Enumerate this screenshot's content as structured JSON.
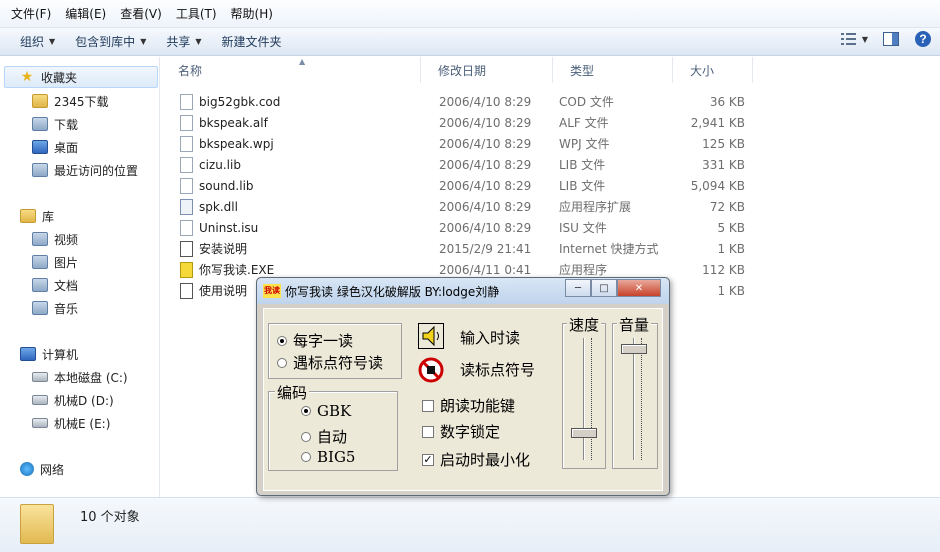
{
  "menu": [
    "文件(F)",
    "编辑(E)",
    "查看(V)",
    "工具(T)",
    "帮助(H)"
  ],
  "toolbar": {
    "organize": "组织",
    "include_in_library": "包含到库中",
    "share": "共享",
    "new_folder": "新建文件夹"
  },
  "sidebar": {
    "favorites": "收藏夹",
    "fav_items": [
      "2345下载",
      "下载",
      "桌面",
      "最近访问的位置"
    ],
    "libraries": "库",
    "lib_items": [
      "视频",
      "图片",
      "文档",
      "音乐"
    ],
    "computer": "计算机",
    "drives": [
      "本地磁盘 (C:)",
      "机械D (D:)",
      "机械E (E:)"
    ],
    "network": "网络"
  },
  "columns": {
    "name": "名称",
    "date": "修改日期",
    "type": "类型",
    "size": "大小"
  },
  "files": [
    {
      "name": "big52gbk.cod",
      "date": "2006/4/10 8:29",
      "type": "COD 文件",
      "size": "36 KB"
    },
    {
      "name": "bkspeak.alf",
      "date": "2006/4/10 8:29",
      "type": "ALF 文件",
      "size": "2,941 KB"
    },
    {
      "name": "bkspeak.wpj",
      "date": "2006/4/10 8:29",
      "type": "WPJ 文件",
      "size": "125 KB"
    },
    {
      "name": "cizu.lib",
      "date": "2006/4/10 8:29",
      "type": "LIB 文件",
      "size": "331 KB"
    },
    {
      "name": "sound.lib",
      "date": "2006/4/10 8:29",
      "type": "LIB 文件",
      "size": "5,094 KB"
    },
    {
      "name": "spk.dll",
      "date": "2006/4/10 8:29",
      "type": "应用程序扩展",
      "size": "72 KB"
    },
    {
      "name": "Uninst.isu",
      "date": "2006/4/10 8:29",
      "type": "ISU 文件",
      "size": "5 KB"
    },
    {
      "name": "安装说明",
      "date": "2015/2/9 21:41",
      "type": "Internet 快捷方式",
      "size": "1 KB"
    },
    {
      "name": "你写我读.EXE",
      "date": "2006/4/11 0:41",
      "type": "应用程序",
      "size": "112 KB"
    },
    {
      "name": "使用说明",
      "date": "",
      "type": "",
      "size": "1 KB"
    }
  ],
  "status": {
    "count": "10 个对象"
  },
  "dialog": {
    "icon_text": "我读",
    "title": "你写我读 绿色汉化破解版 BY:lodge刘静",
    "mode_options": [
      "每字一读",
      "遇标点符号读"
    ],
    "mode_selected": 0,
    "encoding_title": "编码",
    "encoding_options": [
      "GBK",
      "自动",
      "BIG5"
    ],
    "encoding_selected": 0,
    "read_on_input": "输入时读",
    "read_punct": "读标点符号",
    "checkboxes": [
      {
        "label": "朗读功能键",
        "checked": false
      },
      {
        "label": "数字锁定",
        "checked": false
      },
      {
        "label": "启动时最小化",
        "checked": true
      }
    ],
    "speed_title": "速度",
    "volume_title": "音量",
    "speed_level": 0.2,
    "volume_level": 0.95
  }
}
